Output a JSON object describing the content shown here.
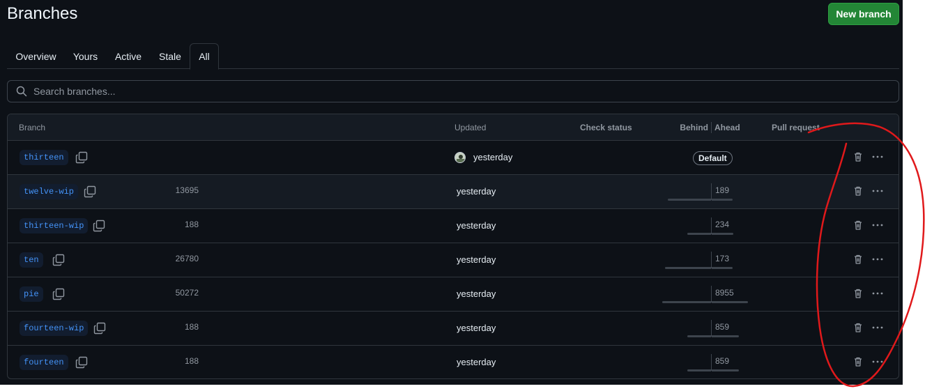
{
  "page": {
    "title": "Branches",
    "new_branch_label": "New branch"
  },
  "tabs": [
    {
      "label": "Overview",
      "selected": false
    },
    {
      "label": "Yours",
      "selected": false
    },
    {
      "label": "Active",
      "selected": false
    },
    {
      "label": "Stale",
      "selected": false
    },
    {
      "label": "All",
      "selected": true
    }
  ],
  "search": {
    "placeholder": "Search branches...",
    "value": "",
    "icon": "search-icon"
  },
  "table": {
    "headers": {
      "branch": "Branch",
      "updated": "Updated",
      "check_status": "Check status",
      "behind": "Behind",
      "ahead": "Ahead",
      "pull_request": "Pull request"
    },
    "rows": [
      {
        "branch": "thirteen",
        "updated": "yesterday",
        "avatar": true,
        "default_badge": "Default",
        "behind": "",
        "ahead": ""
      },
      {
        "branch": "twelve-wip",
        "updated": "yesterday",
        "behind": "13695",
        "ahead": "189"
      },
      {
        "branch": "thirteen-wip",
        "updated": "yesterday",
        "behind": "188",
        "ahead": "234"
      },
      {
        "branch": "ten",
        "updated": "yesterday",
        "behind": "26780",
        "ahead": "173"
      },
      {
        "branch": "pie",
        "updated": "yesterday",
        "behind": "50272",
        "ahead": "8955"
      },
      {
        "branch": "fourteen-wip",
        "updated": "yesterday",
        "behind": "188",
        "ahead": "859"
      },
      {
        "branch": "fourteen",
        "updated": "yesterday",
        "behind": "188",
        "ahead": "859"
      }
    ]
  },
  "row_actions": {
    "delete_icon": "trash-icon",
    "more_icon": "kebab-horizontal-icon"
  },
  "colors": {
    "background": "#0d1117",
    "accent_link": "#4493f8",
    "primary_button": "#238636",
    "annotation": "#e0191b"
  }
}
